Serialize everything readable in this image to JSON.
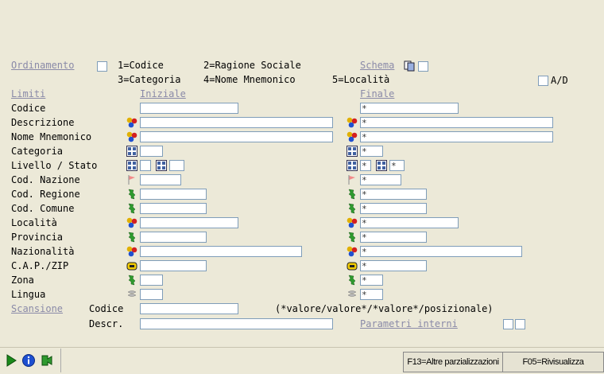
{
  "ordinamento": {
    "label": "Ordinamento",
    "opt1": "1=Codice",
    "opt2": "2=Ragione Sociale",
    "opt3": "3=Categoria",
    "opt4": "4=Nome Mnemonico",
    "opt5": "5=Località",
    "schema_label": "Schema",
    "ad_label": "A/D"
  },
  "headers": {
    "limiti": "Limiti",
    "iniziale": "Iniziale",
    "finale": "Finale"
  },
  "fields": {
    "codice": "Codice",
    "descrizione": "Descrizione",
    "nome_mnemonico": "Nome Mnemonico",
    "categoria": "Categoria",
    "livello_stato": "Livello / Stato",
    "cod_nazione": "Cod. Nazione",
    "cod_regione": "Cod. Regione",
    "cod_comune": "Cod. Comune",
    "localita": "Località",
    "provincia": "Provincia",
    "nazionalita": "Nazionalità",
    "cap_zip": "C.A.P./ZIP",
    "zona": "Zona",
    "lingua": "Lingua"
  },
  "finale_value": "*",
  "scansione": {
    "label": "Scansione",
    "codice_label": "Codice",
    "descr_label": "Descr.",
    "hint": "(*valore/valore*/*valore*/posizionale)",
    "parametri_label": "Parametri interni"
  },
  "buttons": {
    "f13": "F13=Altre parzializzazioni",
    "f05": "F05=Rivisualizza"
  },
  "icons": {
    "multi": "colored-balls-icon",
    "grid": "table-grid-icon",
    "flag": "flag-icon",
    "map": "map-region-icon",
    "phone": "phone-icon",
    "lang": "language-icon",
    "copy": "copy-document-icon"
  }
}
